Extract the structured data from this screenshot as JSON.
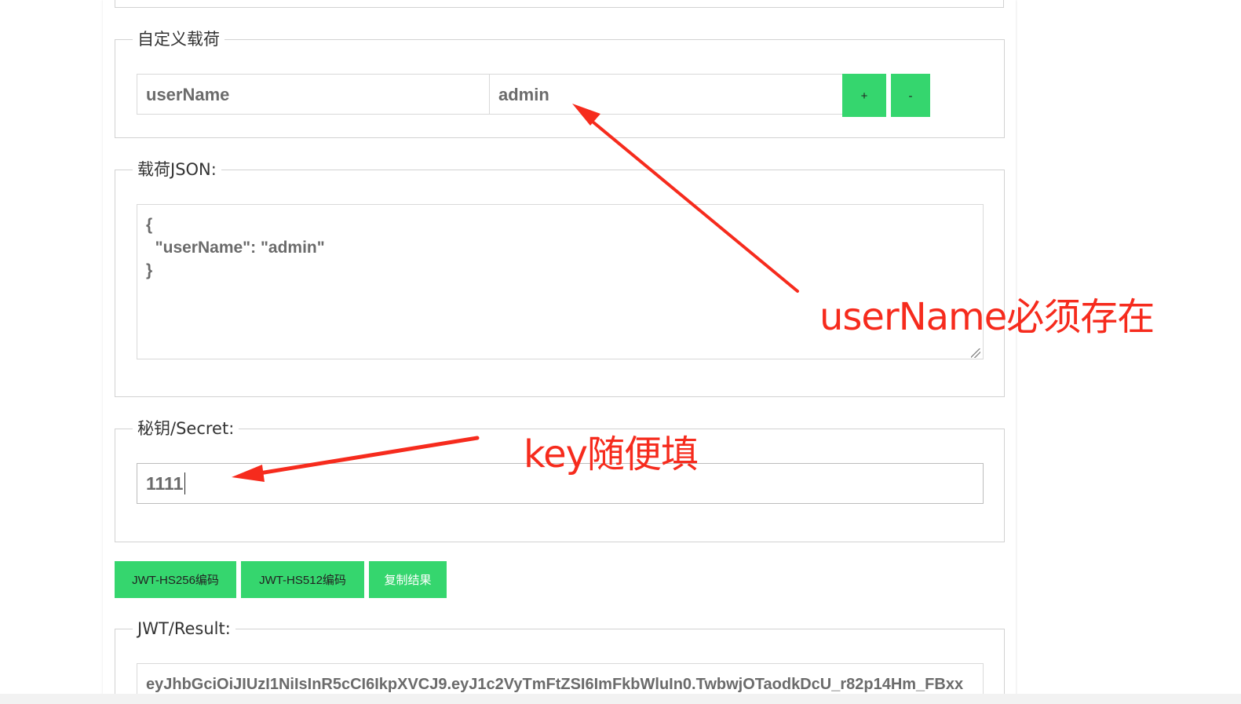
{
  "custom_payload": {
    "legend": "自定义载荷",
    "key_value": "userName",
    "value_value": "admin",
    "add_label": "+",
    "remove_label": "-"
  },
  "payload_json": {
    "legend": "载荷JSON:",
    "value": "{\n  \"userName\": \"admin\"\n}"
  },
  "secret": {
    "legend": "秘钥/Secret:",
    "value": "1111"
  },
  "actions": {
    "hs256_label": "JWT-HS256编码",
    "hs512_label": "JWT-HS512编码",
    "copy_label": "复制结果"
  },
  "result": {
    "legend": "JWT/Result:",
    "value": "eyJhbGciOiJIUzI1NiIsInR5cCI6IkpXVCJ9.eyJ1c2VyTmFtZSI6ImFkbWluIn0.TwbwjOTaodkDcU_r82p14Hm_FBxx"
  },
  "annotations": {
    "username_note": "userName必须存在",
    "key_note": "key随便填"
  },
  "colors": {
    "accent_green": "#35d66e",
    "annotation_red": "#f62b1d"
  }
}
